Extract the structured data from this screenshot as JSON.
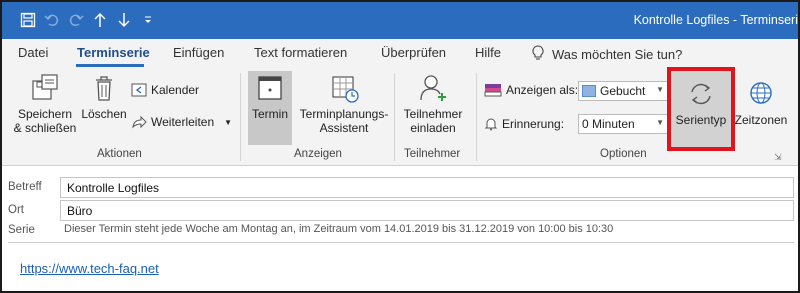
{
  "title": "Kontrolle Logfiles  -  Terminseri",
  "tabs": [
    "Datei",
    "Terminserie",
    "Einfügen",
    "Text formatieren",
    "Überprüfen",
    "Hilfe"
  ],
  "tell_me": "Was möchten Sie tun?",
  "ribbon": {
    "aktionen": {
      "label": "Aktionen",
      "save_close": [
        "Speichern",
        "& schließen"
      ],
      "delete": "Löschen",
      "calendar": "Kalender",
      "forward": "Weiterleiten"
    },
    "anzeigen": {
      "label": "Anzeigen",
      "termin": "Termin",
      "assistant": [
        "Terminplanungs-",
        "Assistent"
      ]
    },
    "teilnehmer": {
      "label": "Teilnehmer",
      "invite": [
        "Teilnehmer",
        "einladen"
      ]
    },
    "optionen": {
      "label": "Optionen",
      "show_as_label": "Anzeigen als:",
      "show_as_value": "Gebucht",
      "reminder_label": "Erinnerung:",
      "reminder_value": "0 Minuten",
      "serientyp": "Serientyp",
      "zeitzonen": "Zeitzonen"
    }
  },
  "form": {
    "betreff_label": "Betreff",
    "betreff_value": "Kontrolle Logfiles",
    "ort_label": "Ort",
    "ort_value": "Büro",
    "serie_label": "Serie",
    "serie_text": "Dieser Termin steht jede Woche am Montag an, im Zeitraum vom 14.01.2019 bis 31.12.2019 von 10:00 bis 10:30",
    "body_link": "https://www.tech-faq.net"
  },
  "colors": {
    "titlebar": "#2b6cbf",
    "highlight": "#e0141b",
    "link": "#1a5fb4"
  }
}
